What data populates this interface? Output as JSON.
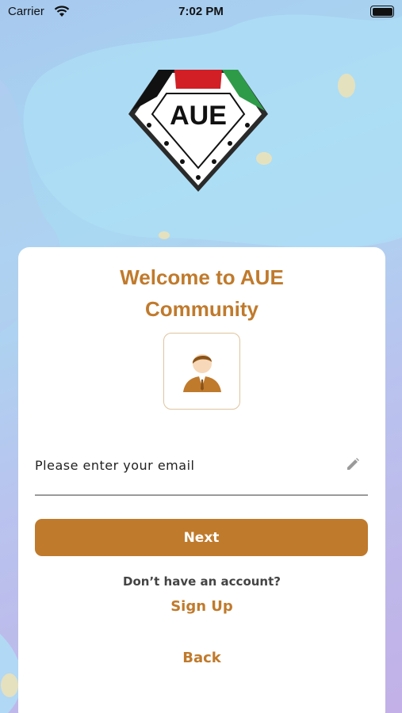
{
  "status_bar": {
    "carrier": "Carrier",
    "time": "7:02 PM"
  },
  "logo": {
    "text": "AUE"
  },
  "card": {
    "title_line1": "Welcome to AUE",
    "title_line2": "Community",
    "email_placeholder": "Please enter your email",
    "email_value": "",
    "next_label": "Next",
    "no_account_text": "Don’t have an account?",
    "signup_label": "Sign Up",
    "back_label": "Back"
  },
  "colors": {
    "accent": "#c07a2c",
    "card_background": "#ffffff",
    "underline": "#9a9a9a"
  }
}
